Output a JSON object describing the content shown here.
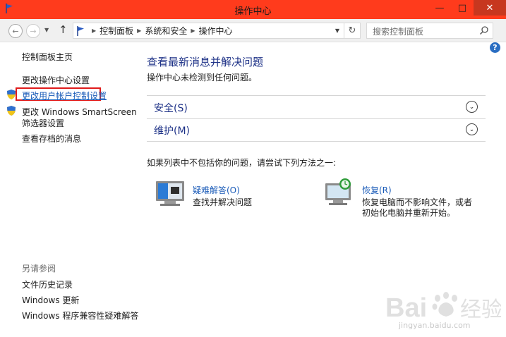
{
  "window": {
    "title": "操作中心"
  },
  "window_buttons": {
    "minimize": "—",
    "maximize": "□",
    "close": "✕"
  },
  "nav": {
    "breadcrumbs": [
      "控制面板",
      "系统和安全",
      "操作中心"
    ],
    "search_placeholder": "搜索控制面板"
  },
  "left": {
    "home": "控制面板主页",
    "links": [
      "更改操作中心设置",
      "更改用户帐户控制设置",
      "更改 Windows SmartScreen",
      "筛选器设置",
      "查看存档的消息"
    ],
    "see_also_heading": "另请参阅",
    "see_also": [
      "文件历史记录",
      "Windows 更新",
      "Windows 程序兼容性疑难解答"
    ]
  },
  "main": {
    "title": "查看最新消息并解决问题",
    "subtitle": "操作中心未检测到任何问题。",
    "sections": [
      "安全(S)",
      "维护(M)"
    ],
    "hint": "如果列表中不包括你的问题，请尝试下列方法之一:",
    "tools": [
      {
        "link": "疑难解答(O)",
        "desc_lines": [
          "查找并解决问题"
        ]
      },
      {
        "link": "恢复(R)",
        "desc_lines": [
          "恢复电脑而不影响文件，或者",
          "初始化电脑并重新开始。"
        ]
      }
    ]
  },
  "watermark": {
    "brand": "Baidu经验",
    "site": "jingyan.baidu.com"
  },
  "colors": {
    "titlebar": "#ff3b1c",
    "link": "#1e3287",
    "highlight": "#e01b1b"
  },
  "icons": [
    "flag-icon",
    "back-icon",
    "forward-icon",
    "up-arrow-icon",
    "refresh-icon",
    "search-icon",
    "help-icon",
    "uac-shield-icon",
    "troubleshoot-icon",
    "recovery-icon",
    "expand-chevron-icon"
  ]
}
